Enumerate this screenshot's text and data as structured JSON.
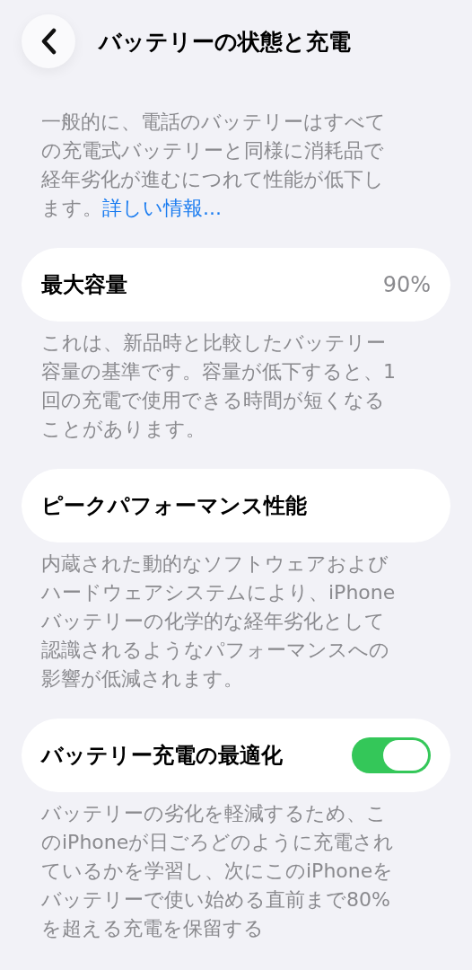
{
  "header": {
    "title": "バッテリーの状態と充電"
  },
  "intro": {
    "text": "一般的に、電話のバッテリーはすべての充電式バッテリーと同様に消耗品で経年劣化が進むにつれて性能が低下します。",
    "link": "詳しい情報..."
  },
  "sections": [
    {
      "kind": "value",
      "label": "最大容量",
      "value": "90%",
      "footer": "これは、新品時と比較したバッテリー容量の基準です。容量が低下すると、1回の充電で使用できる時間が短くなることがあります。"
    },
    {
      "kind": "plain",
      "label": "ピークパフォーマンス性能",
      "footer": "内蔵された動的なソフトウェアおよびハードウェアシステムにより、iPhoneバッテリーの化学的な経年劣化として認識されるようなパフォーマンスへの影響が低減されます。"
    },
    {
      "kind": "toggle",
      "label": "バッテリー充電の最適化",
      "on": true,
      "footer": "バッテリーの劣化を軽減するため、このiPhoneが日ごろどのように充電されているかを学習し、次にこのiPhoneをバッテリーで使い始める直前まで80%を超える充電を保留する"
    }
  ]
}
